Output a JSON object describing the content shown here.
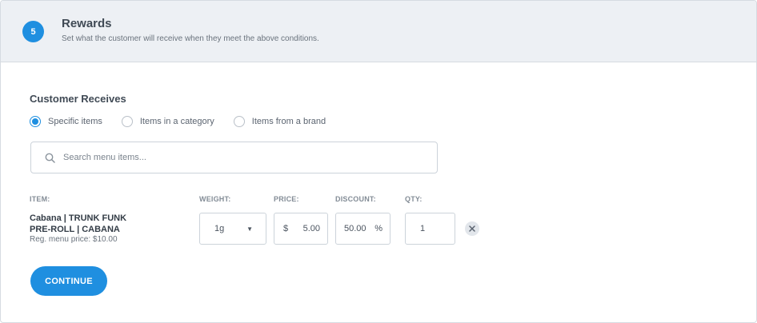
{
  "header": {
    "step": "5",
    "title": "Rewards",
    "subtitle": "Set what the customer will receive when they meet the above conditions."
  },
  "rewards": {
    "section_title": "Customer Receives",
    "options": [
      {
        "label": "Specific items",
        "checked": true
      },
      {
        "label": "Items in a category",
        "checked": false
      },
      {
        "label": "Items from a brand",
        "checked": false
      }
    ],
    "search": {
      "placeholder": "Search menu items...",
      "value": "",
      "icon": "search-icon"
    }
  },
  "table": {
    "headers": {
      "item": "ITEM:",
      "weight": "WEIGHT:",
      "price": "PRICE:",
      "discount": "DISCOUNT:",
      "qty": "QTY:"
    },
    "row": {
      "name_line1": "Cabana | TRUNK FUNK",
      "name_line2": "PRE-ROLL | CABANA",
      "reg_price": "Reg. menu price: $10.00",
      "weight": "1g",
      "price_symbol": "$",
      "price": "5.00",
      "discount": "50.00",
      "discount_symbol": "%",
      "qty": "1"
    }
  },
  "actions": {
    "continue_label": "CONTINUE"
  },
  "colors": {
    "accent": "#1f8fe0",
    "header_bg": "#edf0f4"
  }
}
